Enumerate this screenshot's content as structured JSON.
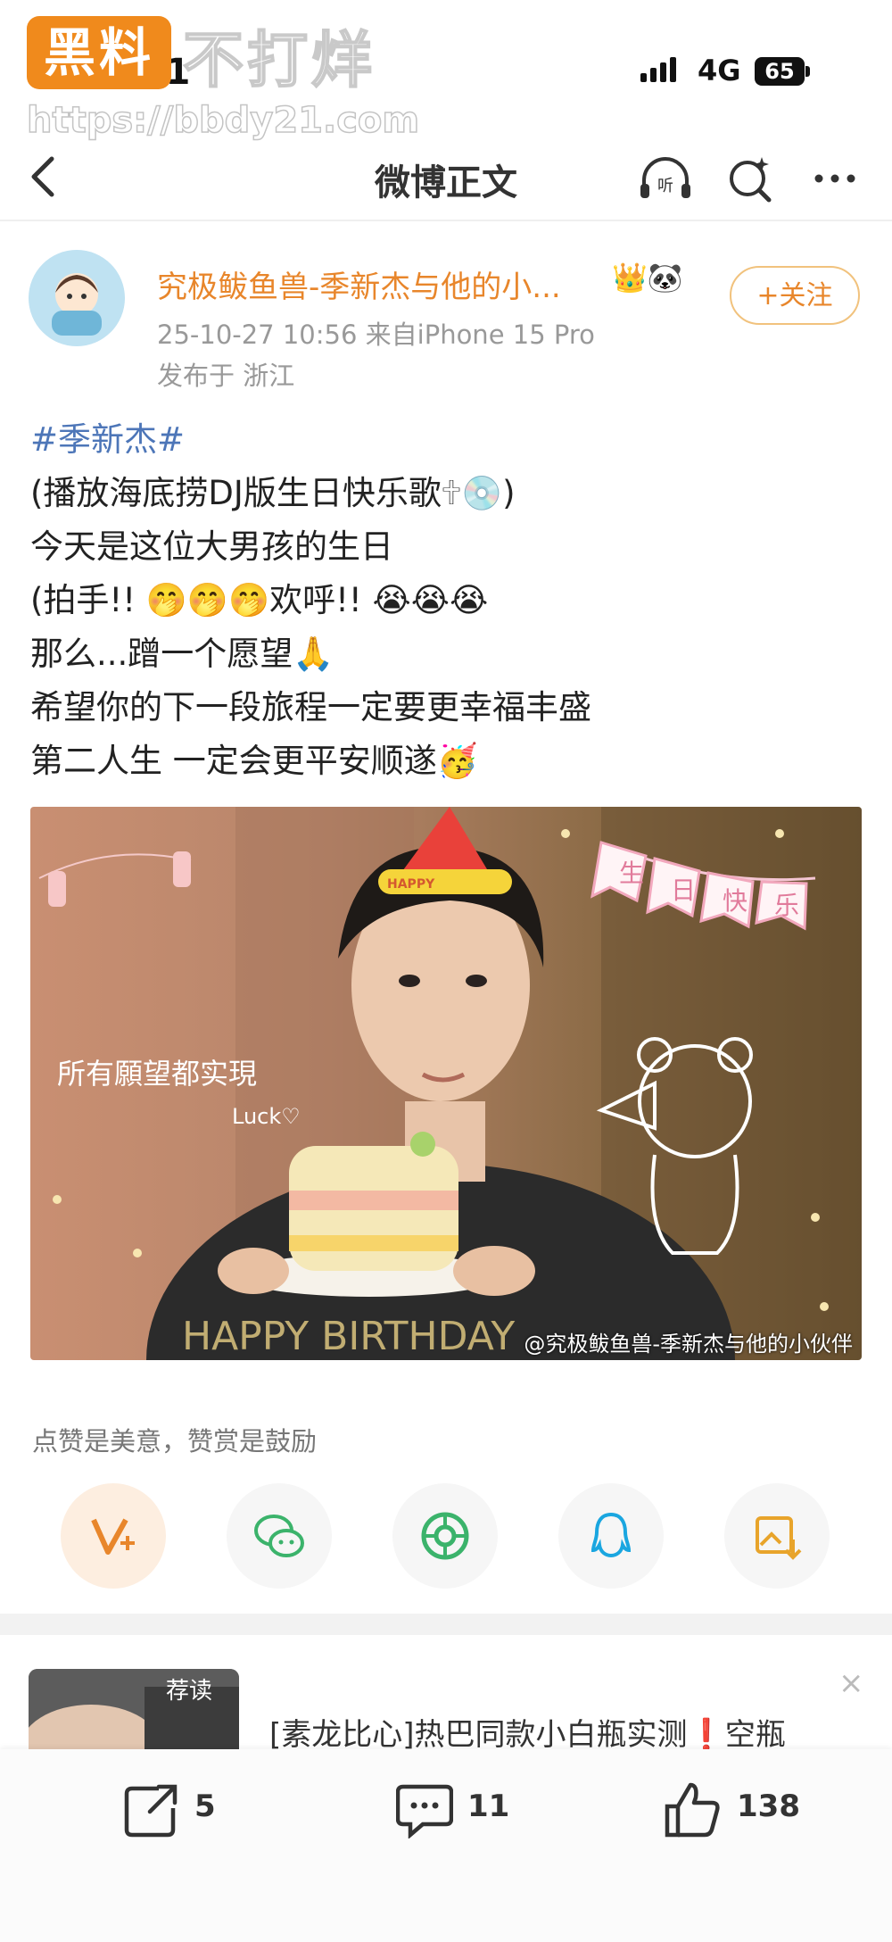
{
  "status_bar": {
    "time": "18:01",
    "network": "4G",
    "battery": "65"
  },
  "watermark": {
    "badge": "黑料",
    "text": "不打烊",
    "url": "https://bbdy21.com"
  },
  "nav": {
    "title": "微博正文"
  },
  "author": {
    "name": "究极鲅鱼兽-季新杰与他的小...",
    "meta": "25-10-27 10:56  来自iPhone 15 Pro",
    "location": "发布于 浙江",
    "follow_label": "+关注"
  },
  "post": {
    "hashtag": "#季新杰#",
    "lines": [
      "(播放海底捞DJ版生日快乐歌🕆💿)",
      "今天是这位大男孩的生日",
      "(拍手!!  🤭🤭🤭欢呼!!  😭😭😭",
      "那么...蹭一个愿望🙏",
      "希望你的下一段旅程一定要更幸福丰盛",
      "第二人生 一定会更平安顺遂🥳"
    ]
  },
  "photo": {
    "banner": [
      "生",
      "日",
      "快",
      "乐"
    ],
    "wish_text": "所有願望都实現",
    "luck_text": "Luck♡",
    "happy_text": "HAPPY BIRTHDAY",
    "hat_text": "HAPPY",
    "credit": "@究极鲅鱼兽-季新杰与他的小伙伴"
  },
  "reward": {
    "text": "点赞是美意，赞赏是鼓励"
  },
  "recommend": {
    "tag": "荐读",
    "title": "[素龙比心]热巴同款小白瓶实测❗空瓶",
    "close": "×"
  },
  "actions": {
    "repost": "5",
    "comment": "11",
    "like": "138"
  },
  "colors": {
    "accent": "#e8862b",
    "link": "#4d76b8"
  }
}
